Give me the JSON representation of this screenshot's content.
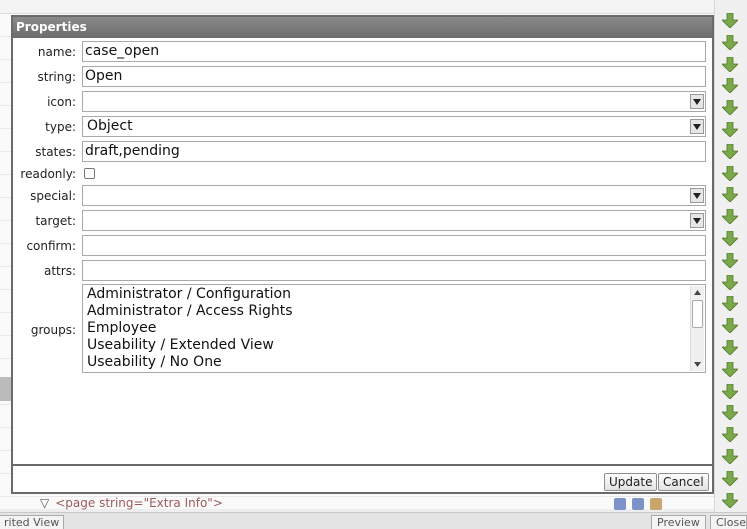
{
  "dialog": {
    "title": "Properties",
    "fields": {
      "name": {
        "label": "name:",
        "value": "case_open"
      },
      "string": {
        "label": "string:",
        "value": "Open"
      },
      "icon": {
        "label": "icon:",
        "value": ""
      },
      "type": {
        "label": "type:",
        "value": "Object"
      },
      "states": {
        "label": "states:",
        "value": "draft,pending"
      },
      "readonly": {
        "label": "readonly:",
        "checked": false
      },
      "special": {
        "label": "special:",
        "value": ""
      },
      "target": {
        "label": "target:",
        "value": ""
      },
      "confirm": {
        "label": "confirm:",
        "value": ""
      },
      "attrs": {
        "label": "attrs:",
        "value": ""
      },
      "groups": {
        "label": "groups:",
        "options": [
          "Administrator / Configuration",
          "Administrator / Access Rights",
          "Employee",
          "Useability / Extended View",
          "Useability / No One"
        ]
      }
    },
    "buttons": {
      "update": "Update",
      "cancel": "Cancel"
    }
  },
  "background": {
    "xml_line": "<page string=\"Extra Info\">",
    "bottom_left_button": "rited View",
    "preview_button": "Preview",
    "close_button": "Close"
  },
  "colors": {
    "titlebar": "#6c6c6c",
    "arrow_green": "#7aa84a"
  },
  "icons": {
    "arrow": "down-arrow-icon",
    "dropdown": "chevron-down-icon"
  }
}
